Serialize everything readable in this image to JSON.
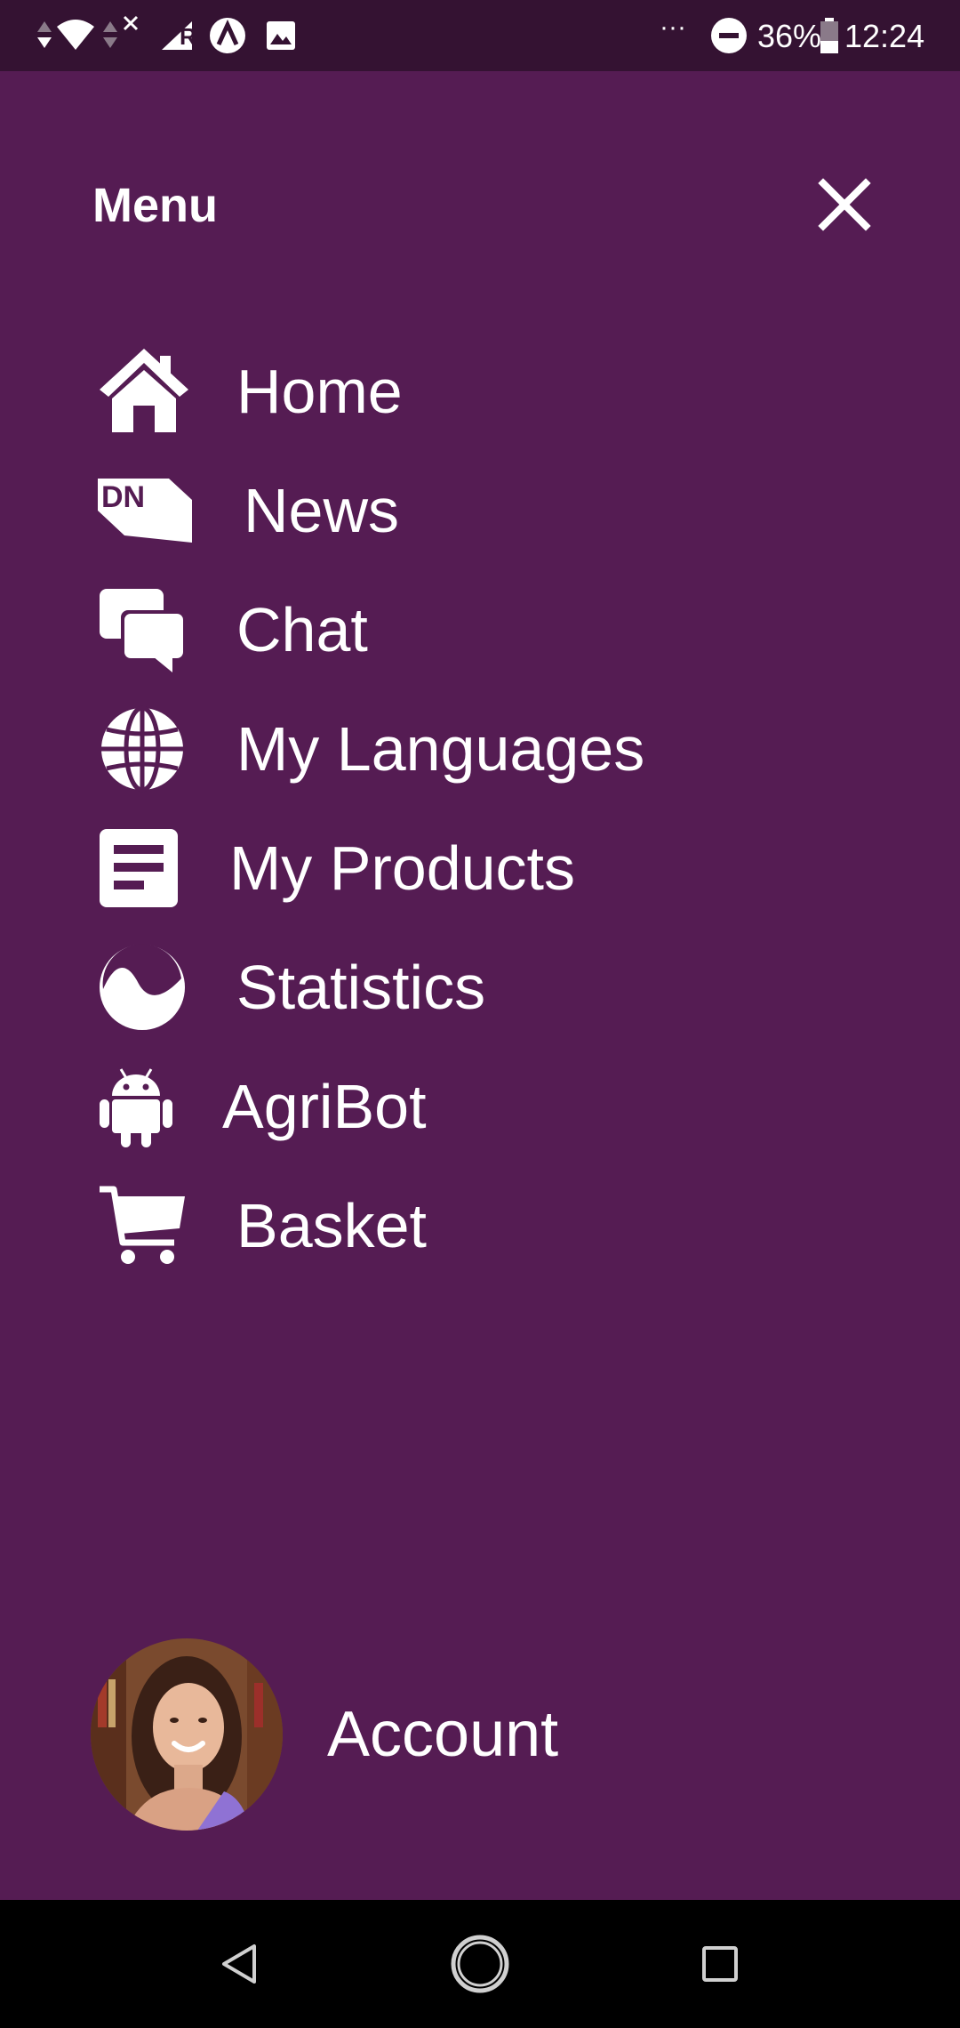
{
  "status_bar": {
    "battery": "36%",
    "time": "12:24",
    "overflow": "···"
  },
  "header": {
    "title": "Menu"
  },
  "menu": {
    "items": [
      {
        "label": "Home",
        "icon": "home-icon"
      },
      {
        "label": "News",
        "icon": "news-icon"
      },
      {
        "label": "Chat",
        "icon": "chat-icon"
      },
      {
        "label": "My Languages",
        "icon": "globe-icon"
      },
      {
        "label": "My Products",
        "icon": "document-icon"
      },
      {
        "label": "Statistics",
        "icon": "statistics-icon"
      },
      {
        "label": "AgriBot",
        "icon": "android-icon"
      },
      {
        "label": "Basket",
        "icon": "cart-icon"
      }
    ]
  },
  "account": {
    "label": "Account"
  },
  "colors": {
    "background": "#551c53",
    "status_bar": "#341232",
    "nav_bar": "#000000",
    "text": "#ffffff"
  }
}
